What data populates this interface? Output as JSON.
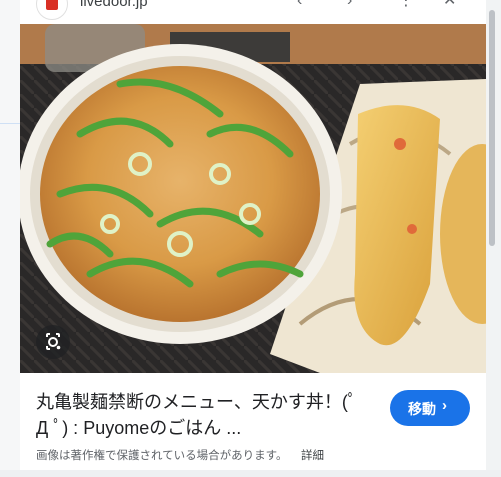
{
  "header": {
    "site": "livedoor.jp",
    "icons": [
      "chevron-left-icon",
      "chevron-right-icon",
      "more-vert-icon",
      "close-icon"
    ]
  },
  "image": {
    "subject": "udon bowl with green onions and tenkasu, fried tempura on a plate",
    "lens_icon": "lens-icon"
  },
  "caption": {
    "title_line1": "丸亀製麺禁断のメニュー、天かす丼！(ﾟ",
    "title_line2": "Д ﾟ) : Puyomeのごはん ...",
    "move_button": "移動",
    "move_chevron": "›",
    "copyright_notice": "画像は著作権で保護されている場合があります。",
    "details_link": "詳細"
  },
  "colors": {
    "accent": "#1a73e8",
    "text": "#202124",
    "muted": "#5f6368"
  }
}
